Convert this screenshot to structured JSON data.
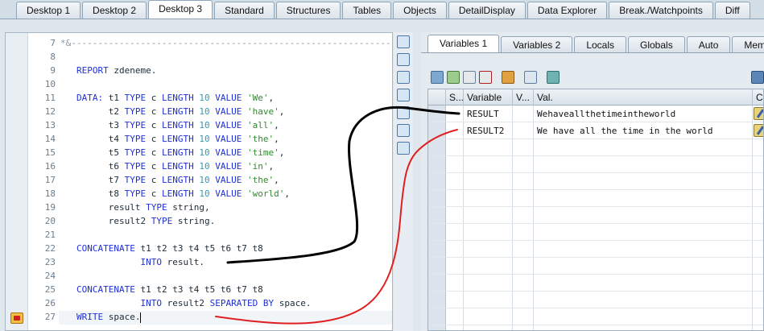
{
  "top_tabs": [
    "Desktop 1",
    "Desktop 2",
    "Desktop 3",
    "Standard",
    "Structures",
    "Tables",
    "Objects",
    "DetailDisplay",
    "Data Explorer",
    "Break./Watchpoints",
    "Diff"
  ],
  "active_top_tab": "Desktop 3",
  "editor": {
    "lines": [
      {
        "no": "7",
        "segments": [
          [
            "cm",
            "*&---------------------------------------------------------------------"
          ]
        ]
      },
      {
        "no": "8",
        "segments": []
      },
      {
        "no": "9",
        "segments": [
          [
            "kw",
            "REPORT"
          ],
          [
            "tx",
            " zdeneme."
          ]
        ]
      },
      {
        "no": "10",
        "segments": []
      },
      {
        "no": "11",
        "segments": [
          [
            "kw",
            "DATA:"
          ],
          [
            "tx",
            " t1 "
          ],
          [
            "kw",
            "TYPE"
          ],
          [
            "tx",
            " c "
          ],
          [
            "kw",
            "LENGTH"
          ],
          [
            "tx",
            " "
          ],
          [
            "nm",
            "10"
          ],
          [
            "tx",
            " "
          ],
          [
            "kw",
            "VALUE"
          ],
          [
            "tx",
            " "
          ],
          [
            "st",
            "'We'"
          ],
          [
            "tx",
            ","
          ]
        ]
      },
      {
        "no": "12",
        "segments": [
          [
            "tx",
            "      t2 "
          ],
          [
            "kw",
            "TYPE"
          ],
          [
            "tx",
            " c "
          ],
          [
            "kw",
            "LENGTH"
          ],
          [
            "tx",
            " "
          ],
          [
            "nm",
            "10"
          ],
          [
            "tx",
            " "
          ],
          [
            "kw",
            "VALUE"
          ],
          [
            "tx",
            " "
          ],
          [
            "st",
            "'have'"
          ],
          [
            "tx",
            ","
          ]
        ]
      },
      {
        "no": "13",
        "segments": [
          [
            "tx",
            "      t3 "
          ],
          [
            "kw",
            "TYPE"
          ],
          [
            "tx",
            " c "
          ],
          [
            "kw",
            "LENGTH"
          ],
          [
            "tx",
            " "
          ],
          [
            "nm",
            "10"
          ],
          [
            "tx",
            " "
          ],
          [
            "kw",
            "VALUE"
          ],
          [
            "tx",
            " "
          ],
          [
            "st",
            "'all'"
          ],
          [
            "tx",
            ","
          ]
        ]
      },
      {
        "no": "14",
        "segments": [
          [
            "tx",
            "      t4 "
          ],
          [
            "kw",
            "TYPE"
          ],
          [
            "tx",
            " c "
          ],
          [
            "kw",
            "LENGTH"
          ],
          [
            "tx",
            " "
          ],
          [
            "nm",
            "10"
          ],
          [
            "tx",
            " "
          ],
          [
            "kw",
            "VALUE"
          ],
          [
            "tx",
            " "
          ],
          [
            "st",
            "'the'"
          ],
          [
            "tx",
            ","
          ]
        ]
      },
      {
        "no": "15",
        "segments": [
          [
            "tx",
            "      t5 "
          ],
          [
            "kw",
            "TYPE"
          ],
          [
            "tx",
            " c "
          ],
          [
            "kw",
            "LENGTH"
          ],
          [
            "tx",
            " "
          ],
          [
            "nm",
            "10"
          ],
          [
            "tx",
            " "
          ],
          [
            "kw",
            "VALUE"
          ],
          [
            "tx",
            " "
          ],
          [
            "st",
            "'time'"
          ],
          [
            "tx",
            ","
          ]
        ]
      },
      {
        "no": "16",
        "segments": [
          [
            "tx",
            "      t6 "
          ],
          [
            "kw",
            "TYPE"
          ],
          [
            "tx",
            " c "
          ],
          [
            "kw",
            "LENGTH"
          ],
          [
            "tx",
            " "
          ],
          [
            "nm",
            "10"
          ],
          [
            "tx",
            " "
          ],
          [
            "kw",
            "VALUE"
          ],
          [
            "tx",
            " "
          ],
          [
            "st",
            "'in'"
          ],
          [
            "tx",
            ","
          ]
        ]
      },
      {
        "no": "17",
        "segments": [
          [
            "tx",
            "      t7 "
          ],
          [
            "kw",
            "TYPE"
          ],
          [
            "tx",
            " c "
          ],
          [
            "kw",
            "LENGTH"
          ],
          [
            "tx",
            " "
          ],
          [
            "nm",
            "10"
          ],
          [
            "tx",
            " "
          ],
          [
            "kw",
            "VALUE"
          ],
          [
            "tx",
            " "
          ],
          [
            "st",
            "'the'"
          ],
          [
            "tx",
            ","
          ]
        ]
      },
      {
        "no": "18",
        "segments": [
          [
            "tx",
            "      t8 "
          ],
          [
            "kw",
            "TYPE"
          ],
          [
            "tx",
            " c "
          ],
          [
            "kw",
            "LENGTH"
          ],
          [
            "tx",
            " "
          ],
          [
            "nm",
            "10"
          ],
          [
            "tx",
            " "
          ],
          [
            "kw",
            "VALUE"
          ],
          [
            "tx",
            " "
          ],
          [
            "st",
            "'world'"
          ],
          [
            "tx",
            ","
          ]
        ]
      },
      {
        "no": "19",
        "segments": [
          [
            "tx",
            "      result "
          ],
          [
            "kw",
            "TYPE"
          ],
          [
            "tx",
            " string,"
          ]
        ]
      },
      {
        "no": "20",
        "segments": [
          [
            "tx",
            "      result2 "
          ],
          [
            "kw",
            "TYPE"
          ],
          [
            "tx",
            " string."
          ]
        ]
      },
      {
        "no": "21",
        "segments": []
      },
      {
        "no": "22",
        "segments": [
          [
            "kw",
            "CONCATENATE"
          ],
          [
            "tx",
            " t1 t2 t3 t4 t5 t6 t7 t8"
          ]
        ]
      },
      {
        "no": "23",
        "segments": [
          [
            "tx",
            "            "
          ],
          [
            "kw",
            "INTO"
          ],
          [
            "tx",
            " result."
          ]
        ]
      },
      {
        "no": "24",
        "segments": []
      },
      {
        "no": "25",
        "segments": [
          [
            "kw",
            "CONCATENATE"
          ],
          [
            "tx",
            " t1 t2 t3 t4 t5 t6 t7 t8"
          ]
        ]
      },
      {
        "no": "26",
        "segments": [
          [
            "tx",
            "            "
          ],
          [
            "kw",
            "INTO"
          ],
          [
            "tx",
            " result2 "
          ],
          [
            "kw",
            "SEPARATED BY"
          ],
          [
            "tx",
            " space."
          ]
        ]
      },
      {
        "no": "27",
        "segments": [
          [
            "kw",
            "WRITE"
          ],
          [
            "tx",
            " space."
          ]
        ]
      }
    ]
  },
  "variables_panel": {
    "tabs": [
      "Variables 1",
      "Variables 2",
      "Locals",
      "Globals",
      "Auto",
      "Memor"
    ],
    "active_tab": "Variables 1",
    "columns": [
      "S...",
      "Variable",
      "V...",
      "Val.",
      "C."
    ],
    "rows": [
      {
        "variable": "RESULT",
        "value": "Wehaveallthetimeintheworld"
      },
      {
        "variable": "RESULT2",
        "value": "We have all the time in the world"
      }
    ]
  },
  "colors": {
    "keyword": "#1f2fd6",
    "string": "#2e8a2e",
    "number": "#2f9db3",
    "annotation_black": "#000000",
    "annotation_red": "#e02020"
  }
}
